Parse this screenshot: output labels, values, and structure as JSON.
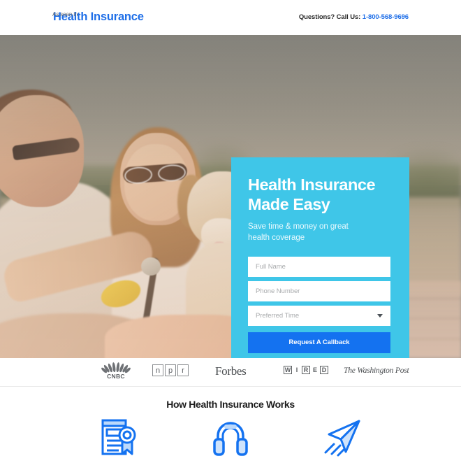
{
  "header": {
    "brand": "Health Insurance",
    "call_label": "Questions? Call Us:",
    "call_number": "1-800-568-9696"
  },
  "hero": {
    "form": {
      "title_line1": "Health Insurance",
      "title_line2": "Made Easy",
      "subtitle_line1": "Save time & money on great",
      "subtitle_line2": "health coverage",
      "fields": [
        {
          "name": "full-name",
          "placeholder": "Full Name",
          "value": "",
          "type": "text"
        },
        {
          "name": "phone-number",
          "placeholder": "Phone Number",
          "value": "",
          "type": "tel"
        },
        {
          "name": "preferred-time",
          "placeholder": "Preferred Time",
          "value": "",
          "type": "select"
        }
      ],
      "cta_label": "Request A Callback",
      "panel_color": "#3fc6e8",
      "cta_color": "#1472f0"
    }
  },
  "logos": {
    "as_seen_label": "As seen in",
    "items": [
      {
        "name": "cnbc",
        "text": "CNBC"
      },
      {
        "name": "npr",
        "letters": [
          "n",
          "p",
          "r"
        ]
      },
      {
        "name": "forbes",
        "text": "Forbes"
      },
      {
        "name": "wired",
        "letters": [
          "W",
          "I",
          "R",
          "E",
          "D"
        ]
      },
      {
        "name": "washington-post",
        "text": "The Washington Post"
      }
    ]
  },
  "how_it_works": {
    "title": "How Health Insurance Works",
    "steps": [
      {
        "icon": "certificate-icon"
      },
      {
        "icon": "headphones-icon"
      },
      {
        "icon": "paper-plane-icon"
      }
    ],
    "icon_color": "#1472f0"
  }
}
